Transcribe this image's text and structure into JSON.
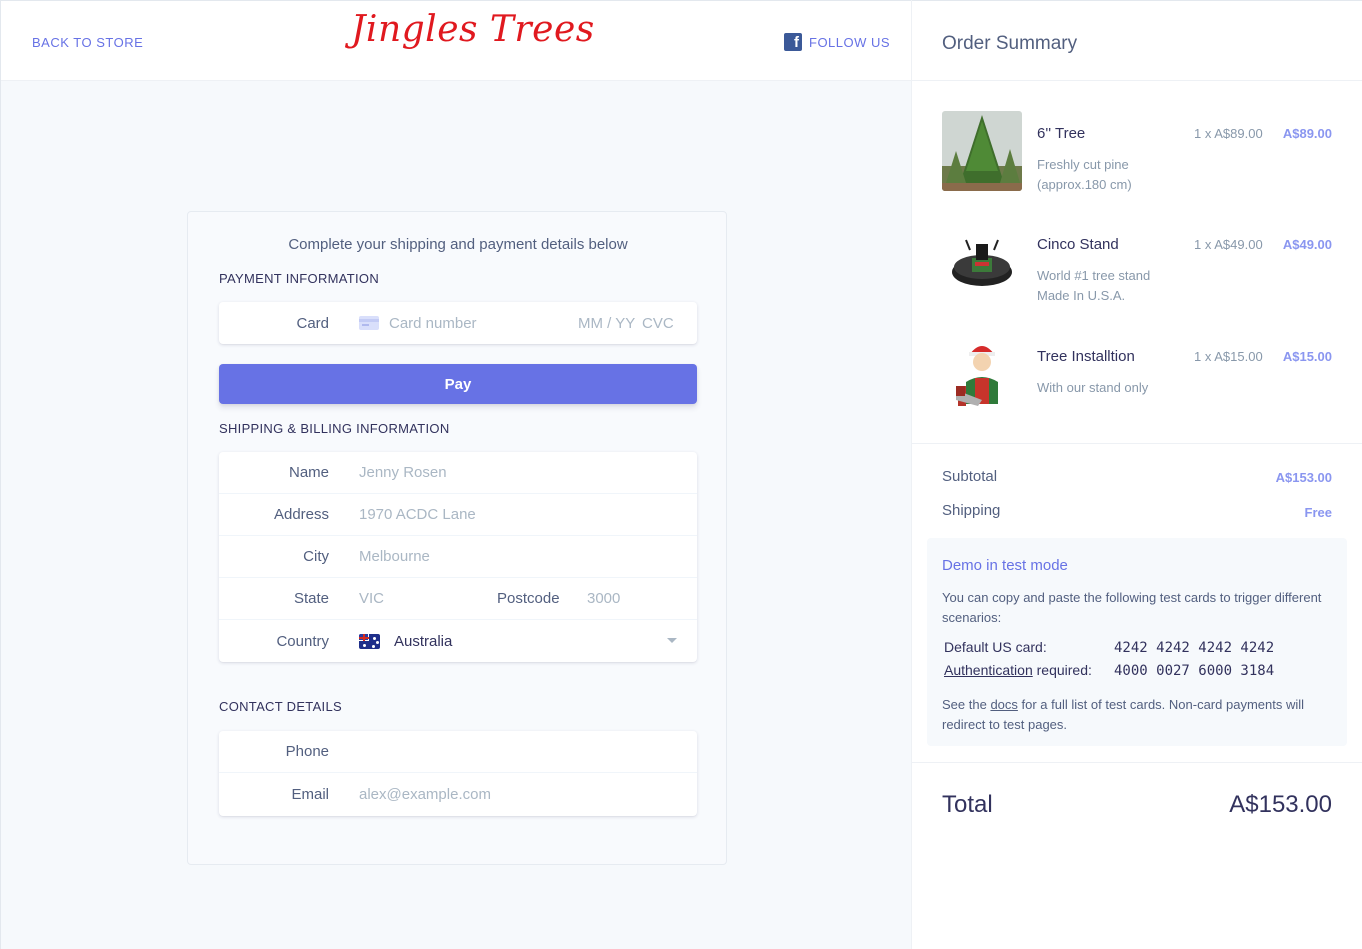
{
  "header": {
    "back_label": "BACK TO STORE",
    "logo_text": "Jingles Trees",
    "follow_label": "FOLLOW US"
  },
  "form": {
    "intro": "Complete your shipping and payment details below",
    "payment_title": "PAYMENT INFORMATION",
    "card_label": "Card",
    "card_number_placeholder": "Card number",
    "expiry_placeholder": "MM / YY",
    "cvc_placeholder": "CVC",
    "pay_label": "Pay",
    "shipping_title": "SHIPPING & BILLING INFORMATION",
    "name_label": "Name",
    "name_placeholder": "Jenny Rosen",
    "address_label": "Address",
    "address_placeholder": "1970 ACDC Lane",
    "city_label": "City",
    "city_placeholder": "Melbourne",
    "state_label": "State",
    "state_placeholder": "VIC",
    "postcode_label": "Postcode",
    "postcode_placeholder": "3000",
    "country_label": "Country",
    "country_value": "Australia",
    "contact_title": "CONTACT DETAILS",
    "phone_label": "Phone",
    "phone_placeholder": "",
    "email_label": "Email",
    "email_placeholder": "alex@example.com"
  },
  "summary": {
    "title": "Order Summary",
    "items": [
      {
        "name": "6'' Tree",
        "desc": "Freshly cut pine (approx.180 cm)",
        "qty": "1 x A$89.00",
        "price": "A$89.00",
        "icon": "pine-tree-photo"
      },
      {
        "name": "Cinco Stand",
        "desc": "World #1 tree stand Made In U.S.A.",
        "qty": "1 x A$49.00",
        "price": "A$49.00",
        "icon": "tree-stand-photo"
      },
      {
        "name": "Tree Installtion",
        "desc": "With our stand only",
        "qty": "1 x A$15.00",
        "price": "A$15.00",
        "icon": "installer-illustration"
      }
    ],
    "subtotal_label": "Subtotal",
    "subtotal_value": "A$153.00",
    "shipping_label": "Shipping",
    "shipping_value": "Free",
    "total_label": "Total",
    "total_value": "A$153.00"
  },
  "demo": {
    "title": "Demo in test mode",
    "text": "You can copy and paste the following test cards to trigger different scenarios:",
    "default_label": "Default US card:",
    "default_card": "4242 4242 4242 4242",
    "auth_link": "Authentication",
    "auth_suffix": " required:",
    "auth_card": "4000 0027 6000 3184",
    "foot_prefix": "See the ",
    "foot_link": "docs",
    "foot_suffix": " for a full list of test cards. Non-card payments will redirect to test pages."
  },
  "colors": {
    "accent": "#6772e5",
    "logo_red": "#e0191f",
    "price_blue": "#8a96f0",
    "facebook": "#3b5998"
  }
}
